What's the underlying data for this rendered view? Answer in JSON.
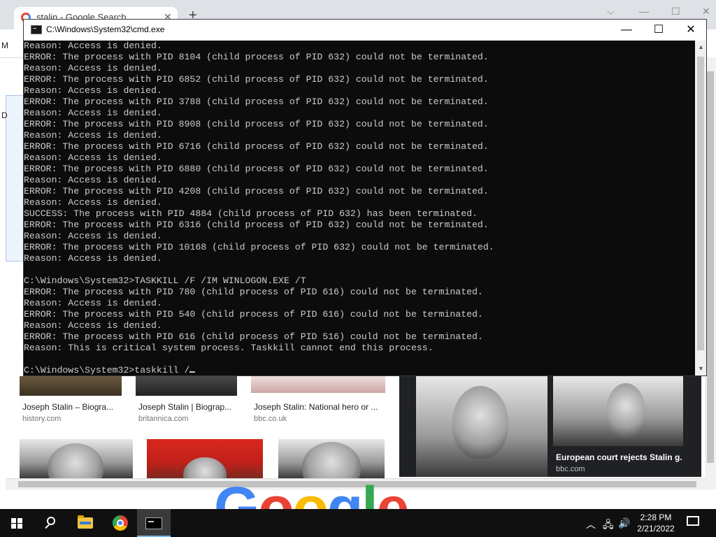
{
  "browser": {
    "tab_title": "stalin - Google Search",
    "tab_close": "✕",
    "new_tab": "+",
    "window_controls": {
      "chevron": "⌵",
      "minimize": "—",
      "maximize": "☐",
      "close": "✕"
    },
    "left_letter_1": "M",
    "left_letter_2": "D",
    "images_row1": [
      {
        "title": "Joseph Stalin – Biogra...",
        "source": "history.com"
      },
      {
        "title": "Joseph Stalin | Biograp...",
        "source": "britannica.com"
      },
      {
        "title": "Joseph Stalin: National hero or ...",
        "source": "bbc.co.uk"
      }
    ],
    "featured": {
      "title": "European court rejects Stalin g...",
      "source": "bbc.com"
    },
    "logo_letters": [
      "G",
      "o",
      "o",
      "g",
      "l",
      "e"
    ]
  },
  "cmd": {
    "title": "C:\\Windows\\System32\\cmd.exe",
    "minimize": "—",
    "maximize": "☐",
    "close": "✕",
    "scroll_up": "▲",
    "scroll_down": "▼",
    "lines": [
      "Reason: Access is denied.",
      "ERROR: The process with PID 8104 (child process of PID 632) could not be terminated.",
      "Reason: Access is denied.",
      "ERROR: The process with PID 6852 (child process of PID 632) could not be terminated.",
      "Reason: Access is denied.",
      "ERROR: The process with PID 3788 (child process of PID 632) could not be terminated.",
      "Reason: Access is denied.",
      "ERROR: The process with PID 8908 (child process of PID 632) could not be terminated.",
      "Reason: Access is denied.",
      "ERROR: The process with PID 6716 (child process of PID 632) could not be terminated.",
      "Reason: Access is denied.",
      "ERROR: The process with PID 6880 (child process of PID 632) could not be terminated.",
      "Reason: Access is denied.",
      "ERROR: The process with PID 4208 (child process of PID 632) could not be terminated.",
      "Reason: Access is denied.",
      "SUCCESS: The process with PID 4884 (child process of PID 632) has been terminated.",
      "ERROR: The process with PID 6316 (child process of PID 632) could not be terminated.",
      "Reason: Access is denied.",
      "ERROR: The process with PID 10168 (child process of PID 632) could not be terminated.",
      "Reason: Access is denied.",
      "",
      "C:\\Windows\\System32>TASKKILL /F /IM WINLOGON.EXE /T",
      "ERROR: The process with PID 780 (child process of PID 616) could not be terminated.",
      "Reason: Access is denied.",
      "ERROR: The process with PID 540 (child process of PID 616) could not be terminated.",
      "Reason: Access is denied.",
      "ERROR: The process with PID 616 (child process of PID 516) could not be terminated.",
      "Reason: This is critical system process. Taskkill cannot end this process.",
      ""
    ],
    "prompt": "C:\\Windows\\System32>taskkill /"
  },
  "taskbar": {
    "tray_chevron": "︿",
    "network": "🖧",
    "volume": "🔊",
    "time": "2:28 PM",
    "date": "2/21/2022"
  }
}
